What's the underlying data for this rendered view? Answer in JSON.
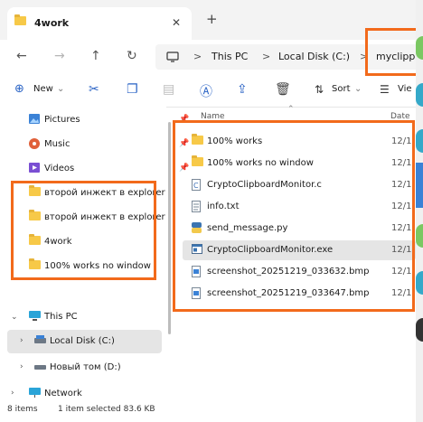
{
  "window": {
    "tab_title": "4work",
    "new_tab_glyph": "+",
    "close_glyph": "✕"
  },
  "nav": {
    "back_glyph": "←",
    "forward_glyph": "→",
    "up_glyph": "↑",
    "refresh_glyph": "↻"
  },
  "breadcrumbs": [
    {
      "label": "This PC"
    },
    {
      "label": "Local Disk (C:)"
    },
    {
      "label": "myclipp"
    }
  ],
  "breadcrumb_separator": ">",
  "commands": {
    "new_label": "New",
    "sort_label": "Sort",
    "view_label": "Vie"
  },
  "sidebar": {
    "quick_access": [
      {
        "label": "Pictures",
        "icon": "pictures-icon"
      },
      {
        "label": "Music",
        "icon": "music-icon"
      },
      {
        "label": "Videos",
        "icon": "videos-icon"
      },
      {
        "label": "второй инжект в explorer",
        "icon": "folder-icon"
      },
      {
        "label": "второй инжект в explorer",
        "icon": "folder-icon"
      },
      {
        "label": "4work",
        "icon": "folder-icon"
      },
      {
        "label": "100% works no window",
        "icon": "folder-icon"
      }
    ],
    "this_pc": "This PC",
    "drives": [
      {
        "label": "Local Disk (C:)"
      },
      {
        "label": "Новый том (D:)"
      }
    ],
    "network": "Network"
  },
  "file_list": {
    "col_name": "Name",
    "col_date": "Date",
    "rows": [
      {
        "name": "100% works",
        "date": "12/1",
        "icon": "folder-icon"
      },
      {
        "name": "100% works no window",
        "date": "12/1",
        "icon": "folder-icon"
      },
      {
        "name": "CryptoClipboardMonitor.c",
        "date": "12/1",
        "icon": "c-file-icon"
      },
      {
        "name": "info.txt",
        "date": "12/1",
        "icon": "text-file-icon"
      },
      {
        "name": "send_message.py",
        "date": "12/1",
        "icon": "python-file-icon"
      },
      {
        "name": "CryptoClipboardMonitor.exe",
        "date": "12/1",
        "icon": "exe-file-icon",
        "selected": true
      },
      {
        "name": "screenshot_20251219_033632.bmp",
        "date": "12/1",
        "icon": "bmp-file-icon"
      },
      {
        "name": "screenshot_20251219_033647.bmp",
        "date": "12/1",
        "icon": "bmp-file-icon"
      }
    ]
  },
  "status": {
    "items": "8 items",
    "selection": "1 item selected  83.6 KB"
  },
  "colors": {
    "highlight": "#f26a1b",
    "accent": "#2a63c5",
    "folder": "#f7c948"
  }
}
